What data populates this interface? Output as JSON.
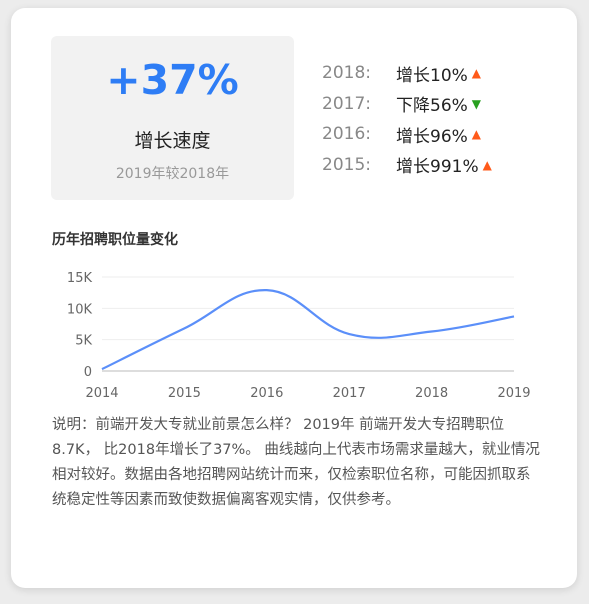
{
  "summary": {
    "big_percent": "+37%",
    "label": "增长速度",
    "comparison": "2019年较2018年"
  },
  "history": [
    {
      "year": "2018:",
      "change": "增长10%",
      "direction": "up"
    },
    {
      "year": "2017:",
      "change": "下降56%",
      "direction": "down"
    },
    {
      "year": "2016:",
      "change": "增长96%",
      "direction": "up"
    },
    {
      "year": "2015:",
      "change": "增长991%",
      "direction": "up"
    }
  ],
  "arrows": {
    "up": "▲",
    "down": "▼"
  },
  "colors": {
    "accent": "#2e7df5",
    "up": "#ff5a1a",
    "down": "#28a020",
    "line": "#5b8ff9"
  },
  "chart_data": {
    "type": "line",
    "title": "历年招聘职位量变化",
    "x": [
      2014,
      2015,
      2016,
      2017,
      2018,
      2019
    ],
    "x_tick_labels": [
      "2014",
      "2015",
      "2016",
      "2017",
      "2018",
      "2019"
    ],
    "series": [
      {
        "values": [
          0.3,
          6.8,
          12.9,
          5.9,
          6.3,
          8.7
        ]
      }
    ],
    "y_ticks": [
      0,
      5,
      10,
      15
    ],
    "y_tick_labels": [
      "0",
      "5K",
      "10K",
      "15K"
    ],
    "ylim": [
      0,
      15
    ],
    "xlabel": "",
    "ylabel": "",
    "grid": true,
    "smooth": true
  },
  "note": "说明：前端开发大专就业前景怎么样？ 2019年 前端开发大专招聘职位 8.7K， 比2018年增长了37%。 曲线越向上代表市场需求量越大，就业情况相对较好。数据由各地招聘网站统计而来，仅检索职位名称，可能因抓取系统稳定性等因素而致使数据偏离客观实情，仅供参考。"
}
